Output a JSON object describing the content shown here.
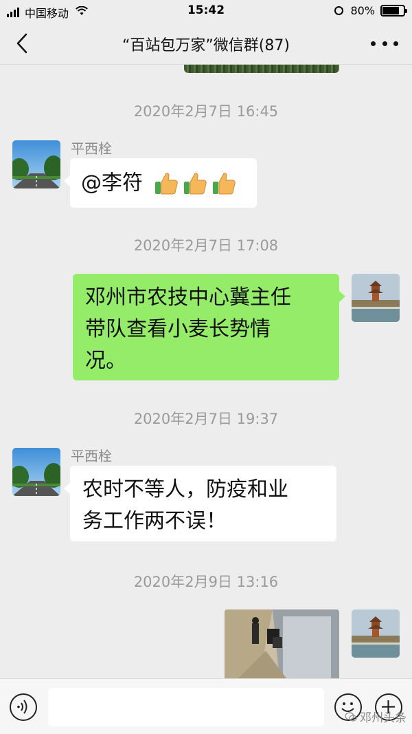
{
  "status_bar": {
    "carrier": "中国移动",
    "time": "15:42",
    "battery_percent": "80%",
    "battery_level": 0.8,
    "icons": [
      "signal-icon",
      "wifi-icon",
      "alarm-icon",
      "battery-icon"
    ]
  },
  "nav": {
    "title": "“百站包万家”微信群(87)",
    "back_icon": "chevron-left-icon",
    "more_icon": "more-dots-icon"
  },
  "messages": [
    {
      "type": "timestamp",
      "text": "2020年2月7日 16:45"
    },
    {
      "type": "incoming",
      "sender": "平西栓",
      "text": "@李符",
      "emoji": [
        "thumbs-up",
        "thumbs-up",
        "thumbs-up"
      ]
    },
    {
      "type": "timestamp",
      "text": "2020年2月7日 17:08"
    },
    {
      "type": "outgoing",
      "lines": [
        "邓州市农技中心冀主任",
        "带队查看小麦长势情",
        "况。"
      ]
    },
    {
      "type": "timestamp",
      "text": "2020年2月7日 19:37"
    },
    {
      "type": "incoming",
      "sender": "平西栓",
      "lines": [
        "农时不等人，防疫和业",
        "务工作两不误！"
      ]
    },
    {
      "type": "timestamp",
      "text": "2020年2月9日 13:16"
    },
    {
      "type": "outgoing-image"
    }
  ],
  "input_bar": {
    "voice_icon": "voice-icon",
    "emoji_icon": "emoji-icon",
    "plus_icon": "plus-icon",
    "input_value": ""
  },
  "watermark": {
    "text": "邓州头条"
  },
  "colors": {
    "background": "#ededed",
    "outgoing_bubble": "#95ec69",
    "incoming_bubble": "#ffffff",
    "timestamp_text": "#9a9a9a"
  }
}
